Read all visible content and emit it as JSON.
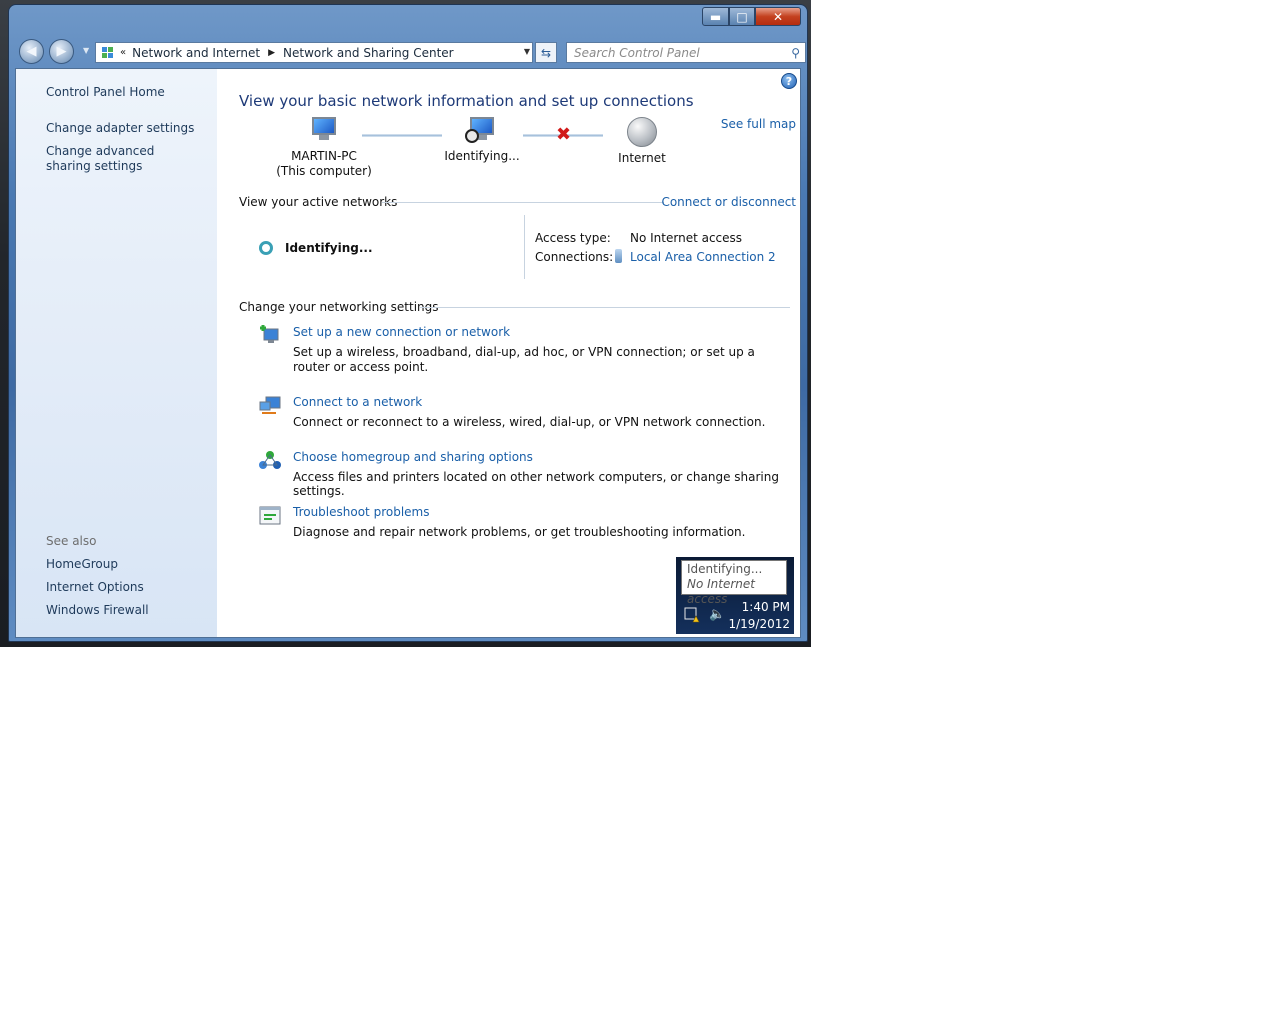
{
  "window": {
    "controls": {
      "minimize": "▬",
      "maximize": "□",
      "close": "✕"
    }
  },
  "nav": {
    "back": "◀",
    "forward": "▶",
    "history_dropdown": "▼",
    "breadcrumb_overflow": "«",
    "crumbs": [
      "Network and Internet",
      "Network and Sharing Center"
    ],
    "crumb_separator": "▶",
    "address_dropdown": "▼",
    "refresh": "⇆",
    "search_placeholder": "Search Control Panel",
    "search_icon": "⚲"
  },
  "sidebar": {
    "home": "Control Panel Home",
    "links": [
      "Change adapter settings",
      "Change advanced sharing settings"
    ],
    "see_also_heading": "See also",
    "see_also": [
      "HomeGroup",
      "Internet Options",
      "Windows Firewall"
    ]
  },
  "main": {
    "help": "?",
    "title": "View your basic network information and set up connections",
    "see_full_map": "See full map",
    "map": {
      "computer_name": "MARTIN-PC",
      "computer_sub": "(This computer)",
      "network": "Identifying...",
      "internet": "Internet",
      "broken_mark": "✖"
    },
    "active_networks": {
      "heading": "View your active networks",
      "connect_link": "Connect or disconnect",
      "network_name": "Identifying...",
      "access_type_label": "Access type:",
      "access_type_value": "No Internet access",
      "connections_label": "Connections:",
      "connections_value": "Local Area Connection 2"
    },
    "settings": {
      "heading": "Change your networking settings",
      "items": [
        {
          "title": "Set up a new connection or network",
          "desc": "Set up a wireless, broadband, dial-up, ad hoc, or VPN connection; or set up a router or access point."
        },
        {
          "title": "Connect to a network",
          "desc": "Connect or reconnect to a wireless, wired, dial-up, or VPN network connection."
        },
        {
          "title": "Choose homegroup and sharing options",
          "desc": "Access files and printers located on other network computers, or change sharing settings."
        },
        {
          "title": "Troubleshoot problems",
          "desc": "Diagnose and repair network problems, or get troubleshooting information."
        }
      ]
    }
  },
  "tray": {
    "tooltip_line1": "Identifying...",
    "tooltip_line2": "No Internet access",
    "time": "1:40 PM",
    "date": "1/19/2012",
    "volume_icon": "🔈"
  }
}
